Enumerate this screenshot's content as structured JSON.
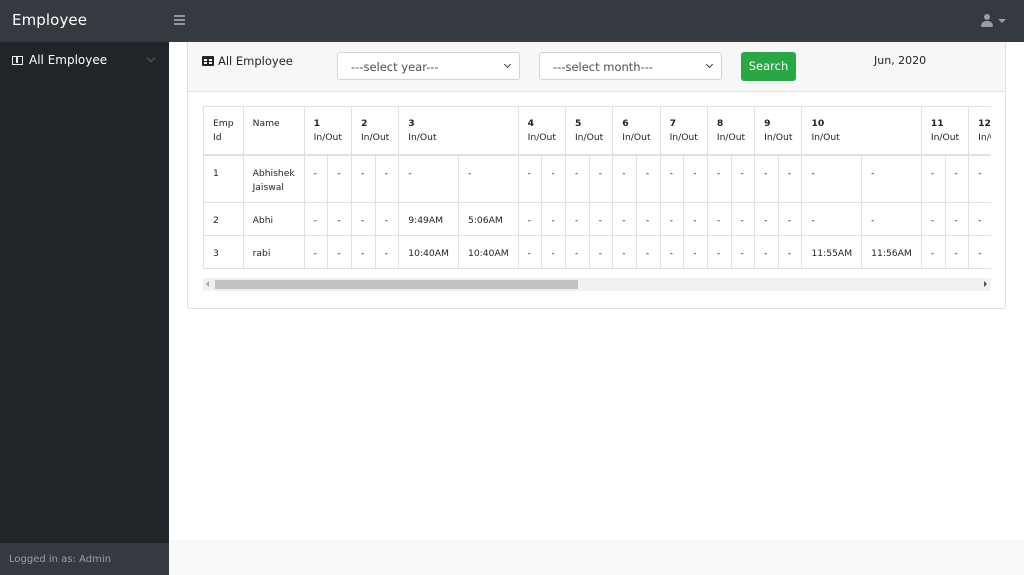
{
  "app": {
    "brand": "Employee"
  },
  "sidebar": {
    "items": [
      {
        "label": "All Employee",
        "icon": "columns-icon"
      }
    ],
    "footer": "Logged in as: Admin"
  },
  "card": {
    "title": "All Employee",
    "year_select": {
      "selected": "---select year---"
    },
    "month_select": {
      "selected": "---select month---"
    },
    "search_label": "Search",
    "period": "Jun, 2020"
  },
  "table": {
    "headers": {
      "emp_id": "Emp Id",
      "name": "Name",
      "sub": "In/Out"
    },
    "days": [
      "1",
      "2",
      "3",
      "4",
      "5",
      "6",
      "7",
      "8",
      "9",
      "10",
      "11",
      "12"
    ],
    "rows": [
      {
        "id": "1",
        "name": "Abhishek Jaiswal",
        "times": [
          [
            "-",
            "-"
          ],
          [
            "-",
            "-"
          ],
          [
            "-",
            "-"
          ],
          [
            "-",
            "-"
          ],
          [
            "-",
            "-"
          ],
          [
            "-",
            "-"
          ],
          [
            "-",
            "-"
          ],
          [
            "-",
            "-"
          ],
          [
            "-",
            "-"
          ],
          [
            "-",
            "-"
          ],
          [
            "-",
            "-"
          ],
          [
            "-",
            "-"
          ]
        ]
      },
      {
        "id": "2",
        "name": "Abhi",
        "times": [
          [
            "-",
            "-"
          ],
          [
            "-",
            "-"
          ],
          [
            "9:49AM",
            "5:06AM"
          ],
          [
            "-",
            "-"
          ],
          [
            "-",
            "-"
          ],
          [
            "-",
            "-"
          ],
          [
            "-",
            "-"
          ],
          [
            "-",
            "-"
          ],
          [
            "-",
            "-"
          ],
          [
            "-",
            "-"
          ],
          [
            "-",
            "-"
          ],
          [
            "-",
            "-"
          ]
        ]
      },
      {
        "id": "3",
        "name": "rabi",
        "times": [
          [
            "-",
            "-"
          ],
          [
            "-",
            "-"
          ],
          [
            "10:40AM",
            "10:40AM"
          ],
          [
            "-",
            "-"
          ],
          [
            "-",
            "-"
          ],
          [
            "-",
            "-"
          ],
          [
            "-",
            "-"
          ],
          [
            "-",
            "-"
          ],
          [
            "-",
            "-"
          ],
          [
            "11:55AM",
            "11:56AM"
          ],
          [
            "-",
            "-"
          ],
          [
            "-",
            "-"
          ]
        ]
      }
    ]
  }
}
